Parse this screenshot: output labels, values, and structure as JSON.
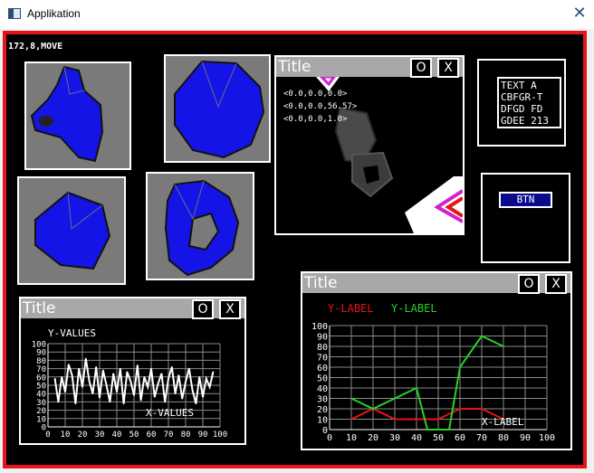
{
  "window": {
    "title": "Applikation",
    "close_label": "✕"
  },
  "status": "172,8,MOVE",
  "thumbnails": [
    {
      "name": "mesh-thumb-1",
      "fill": "#1414e6"
    },
    {
      "name": "mesh-thumb-2",
      "fill": "#1414e6"
    },
    {
      "name": "mesh-thumb-3",
      "fill": "#1414e6"
    },
    {
      "name": "mesh-thumb-4",
      "fill": "#1414e6"
    }
  ],
  "viewer_panel": {
    "title": "Title",
    "btn_o": "O",
    "btn_x": "X",
    "lines": [
      "<0.0,0.0,0.0>",
      "<0.0,0.0,56.57>",
      "<0.0,0.0,1.0>"
    ]
  },
  "text_box": {
    "lines": [
      "TEXT A",
      "CBFGR-T",
      "DFGD FD",
      "GDEE 213"
    ]
  },
  "button": {
    "label": "BTN"
  },
  "small_chart_panel": {
    "title": "Title",
    "btn_o": "O",
    "btn_x": "X"
  },
  "big_chart_panel": {
    "title": "Title",
    "btn_o": "O",
    "btn_x": "X"
  },
  "chart_data": [
    {
      "type": "line",
      "ylabel": "Y-VALUES",
      "xlabel": "X-VALUES",
      "xlim": [
        0,
        100
      ],
      "ylim": [
        0,
        100
      ],
      "x_ticks": [
        "0",
        "10",
        "20",
        "30",
        "40",
        "50",
        "60",
        "70",
        "80",
        "90",
        "100"
      ],
      "y_ticks": [
        "0",
        "10",
        "20",
        "30",
        "40",
        "50",
        "60",
        "70",
        "80",
        "90",
        "100"
      ],
      "grid": true,
      "series": [
        {
          "color": "#ffffff",
          "x": [
            4,
            6,
            8,
            10,
            12,
            14,
            16,
            18,
            20,
            22,
            24,
            26,
            28,
            30,
            32,
            34,
            36,
            38,
            40,
            42,
            44,
            46,
            48,
            50,
            52,
            54,
            56,
            58,
            60,
            62,
            64,
            66,
            68,
            70,
            72,
            74,
            76,
            78,
            80,
            82,
            84,
            86,
            88,
            90,
            92,
            94,
            96
          ],
          "y": [
            58,
            30,
            60,
            42,
            75,
            62,
            28,
            70,
            48,
            82,
            55,
            40,
            72,
            35,
            68,
            50,
            30,
            64,
            42,
            70,
            28,
            66,
            55,
            38,
            74,
            32,
            60,
            48,
            70,
            36,
            52,
            64,
            30,
            58,
            72,
            40,
            62,
            34,
            54,
            70,
            44,
            28,
            60,
            36,
            58,
            48,
            66
          ]
        }
      ]
    },
    {
      "type": "line",
      "legend": [
        "Y-LABEL",
        "Y-LABEL"
      ],
      "xlabel": "X-LABEL",
      "xlim": [
        0,
        100
      ],
      "ylim": [
        0,
        100
      ],
      "x_ticks": [
        "0",
        "10",
        "20",
        "30",
        "40",
        "50",
        "60",
        "70",
        "80",
        "90",
        "100"
      ],
      "y_ticks": [
        "0",
        "10",
        "20",
        "30",
        "40",
        "50",
        "60",
        "70",
        "80",
        "90",
        "100"
      ],
      "grid": true,
      "series": [
        {
          "color": "#e81414",
          "x": [
            10,
            20,
            30,
            40,
            50,
            60,
            70,
            80
          ],
          "y": [
            10,
            20,
            10,
            10,
            10,
            20,
            20,
            10
          ]
        },
        {
          "color": "#28d228",
          "x": [
            10,
            20,
            30,
            40,
            45,
            55,
            60,
            70,
            80
          ],
          "y": [
            30,
            20,
            30,
            40,
            0,
            0,
            60,
            90,
            80
          ]
        }
      ]
    }
  ]
}
